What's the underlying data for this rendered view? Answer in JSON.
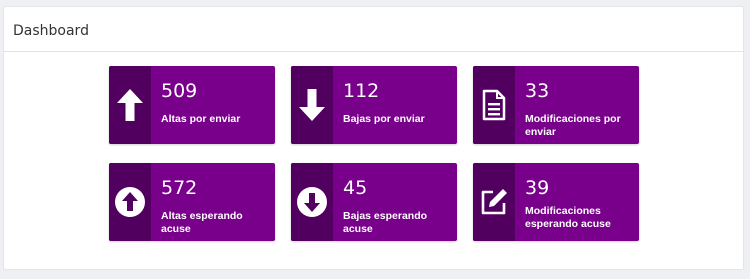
{
  "dashboard": {
    "title": "Dashboard",
    "cards": [
      {
        "count": "509",
        "label": "Altas por enviar",
        "icon": "arrow-up-icon"
      },
      {
        "count": "112",
        "label": "Bajas por enviar",
        "icon": "arrow-down-icon"
      },
      {
        "count": "33",
        "label": "Modificaciones por enviar",
        "icon": "document-icon"
      },
      {
        "count": "572",
        "label": "Altas esperando acuse",
        "icon": "circle-arrow-up-icon"
      },
      {
        "count": "45",
        "label": "Bajas esperando acuse",
        "icon": "circle-arrow-down-icon"
      },
      {
        "count": "39",
        "label": "Modificaciones esperando acuse",
        "icon": "edit-icon"
      }
    ]
  },
  "colors": {
    "card_background": "#78008a",
    "icon_background": "#52005f",
    "text": "#ffffff"
  }
}
